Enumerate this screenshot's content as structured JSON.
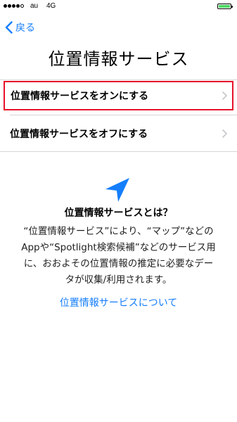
{
  "status_bar": {
    "carrier": "au",
    "network": "4G",
    "signal_strength": 4,
    "signal_max": 5,
    "battery_level": 1.0,
    "battery_color": "#4cd964"
  },
  "nav": {
    "back_label": "戻る"
  },
  "page": {
    "title": "位置情報サービス"
  },
  "options": [
    {
      "label": "位置情報サービスをオンにする",
      "highlighted": true
    },
    {
      "label": "位置情報サービスをオフにする",
      "highlighted": false
    }
  ],
  "info": {
    "heading": "位置情報サービスとは？",
    "body_lines": [
      "“位置情報サービス”により、“マップ”などの",
      "Appや“Spotlight検索候補”などのサービス用",
      "に、おおよその位置情報の推定に必要なデー",
      "タが収集/利用されます。"
    ],
    "link_label": "位置情報サービスについて"
  },
  "colors": {
    "accent": "#147efb",
    "highlight_border": "#e8112a",
    "divider": "#d6d6d6"
  },
  "icons": {
    "back": "chevron-left-icon",
    "row_disclosure": "chevron-right-icon",
    "location": "location-arrow-icon"
  }
}
